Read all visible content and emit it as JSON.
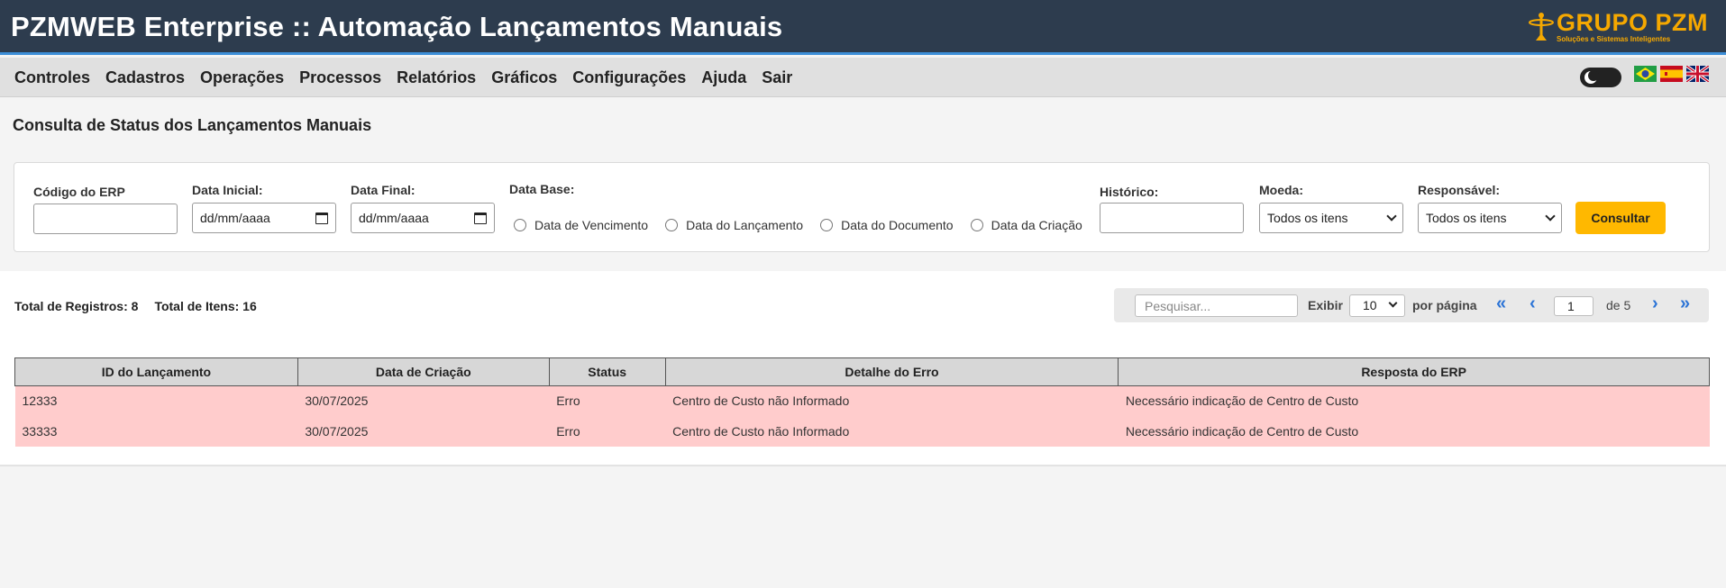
{
  "header": {
    "title": "PZMWEB Enterprise :: Automação Lançamentos Manuais",
    "logo_name": "GRUPO PZM",
    "logo_tagline": "Soluções e Sistemas Inteligentes"
  },
  "menu": {
    "items": [
      "Controles",
      "Cadastros",
      "Operações",
      "Processos",
      "Relatórios",
      "Gráficos",
      "Configurações",
      "Ajuda",
      "Sair"
    ]
  },
  "languages": [
    "pt-BR",
    "es",
    "en"
  ],
  "page": {
    "title": "Consulta de Status dos Lançamentos Manuais"
  },
  "filters": {
    "codigo_erp_label": "Código do ERP",
    "codigo_erp_value": "",
    "data_inicial_label": "Data Inicial:",
    "data_inicial_value": "dd/mm/aaaa",
    "data_final_label": "Data Final:",
    "data_final_value": "dd/mm/aaaa",
    "data_base_label": "Data Base:",
    "data_base_options": [
      "Data de Vencimento",
      "Data do Lançamento",
      "Data do Documento",
      "Data da Criação"
    ],
    "historico_label": "Histórico:",
    "historico_value": "",
    "moeda_label": "Moeda:",
    "moeda_value": "Todos os itens",
    "responsavel_label": "Responsável:",
    "responsavel_value": "Todos os itens",
    "consultar_label": "Consultar"
  },
  "summary": {
    "total_registros": "Total de Registros: 8",
    "total_itens": "Total de Itens: 16"
  },
  "pagination": {
    "search_placeholder": "Pesquisar...",
    "exibir_label": "Exibir",
    "per_page_value": "10",
    "por_pagina_label": "por página",
    "first": "«",
    "prev": "‹",
    "current_page": "1",
    "of_pages": "de 5",
    "next": "›",
    "last": "»"
  },
  "table": {
    "columns": [
      "ID do Lançamento",
      "Data de Criação",
      "Status",
      "Detalhe do Erro",
      "Resposta do ERP"
    ],
    "rows": [
      [
        "12333",
        "30/07/2025",
        "Erro",
        "Centro de Custo não Informado",
        "Necessário indicação de Centro de Custo"
      ],
      [
        "33333",
        "30/07/2025",
        "Erro",
        "Centro de Custo não Informado",
        "Necessário indicação de Centro de Custo"
      ]
    ]
  },
  "colors": {
    "header_bg": "#2d3c4e",
    "accent_line": "#3d8fd8",
    "brand": "#f5a800",
    "button": "#ffb800",
    "error_row": "#ffcccc",
    "link": "#2c74d6"
  }
}
